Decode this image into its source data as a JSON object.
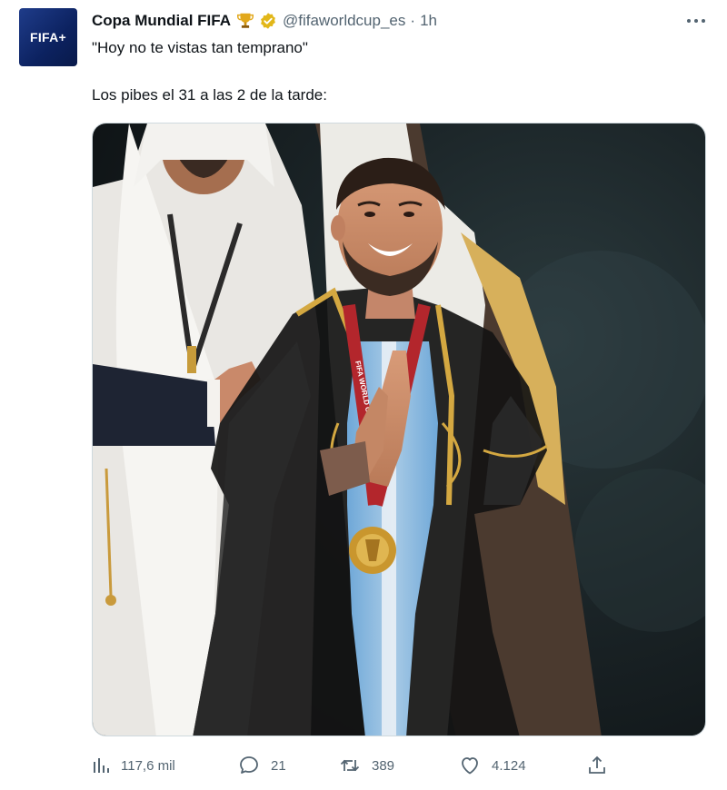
{
  "author": {
    "display_name": "Copa Mundial FIFA",
    "handle": "@fifaworldcup_es",
    "separator": "·",
    "time": "1h",
    "avatar_text": "FIFA+"
  },
  "tweet": {
    "line1": "\"Hoy no te vistas tan temprano\"",
    "line2": "Los pibes el 31 a las 2 de la tarde:"
  },
  "media": {
    "description_icon": "photo",
    "medal_text": "FIFA WORLD CUP Qatar"
  },
  "actions": {
    "views": "117,6 mil",
    "replies": "21",
    "retweets": "389",
    "likes": "4.124"
  },
  "colors": {
    "text": "#0f1419",
    "secondary": "#536471",
    "verified_gold": "#e2b719",
    "border": "#cfd9de"
  }
}
